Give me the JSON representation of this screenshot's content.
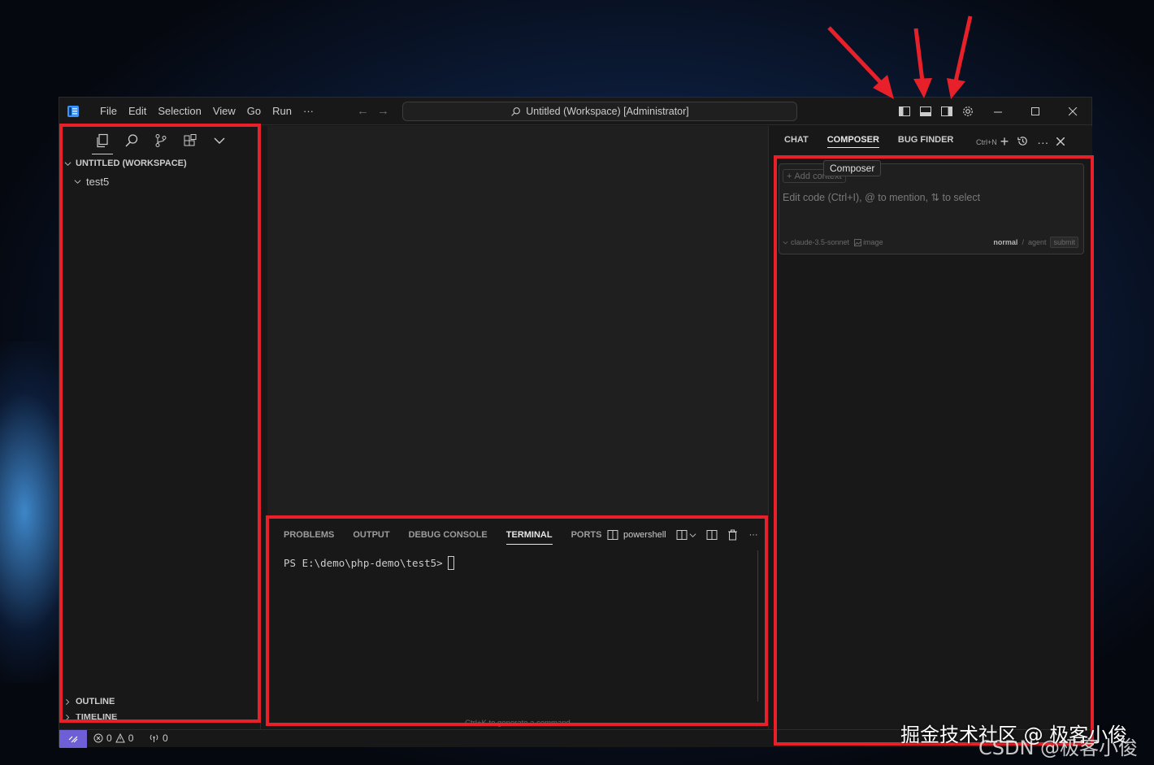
{
  "menu": [
    "File",
    "Edit",
    "Selection",
    "View",
    "Go",
    "Run",
    "···"
  ],
  "command_center": "Untitled (Workspace) [Administrator]",
  "title_icons": [
    "toggle-primary-sidebar-icon",
    "toggle-panel-icon",
    "toggle-secondary-sidebar-icon",
    "gear-icon"
  ],
  "window_controls": [
    "minimize-icon",
    "maximize-icon",
    "close-icon"
  ],
  "sidebar": {
    "activity_icons": [
      "explorer-icon",
      "search-icon",
      "source-control-icon",
      "extensions-icon",
      "chevron-down-icon"
    ],
    "root": "UNTITLED (WORKSPACE)",
    "folder": "test5",
    "outline": "OUTLINE",
    "timeline": "TIMELINE"
  },
  "panel": {
    "tabs": [
      "PROBLEMS",
      "OUTPUT",
      "DEBUG CONSOLE",
      "TERMINAL",
      "PORTS"
    ],
    "active_tab": "TERMINAL",
    "shell": "powershell",
    "prompt": "PS E:\\demo\\php-demo\\test5>",
    "hint": "Ctrl+K to generate a command"
  },
  "rightpane": {
    "tabs": [
      "CHAT",
      "COMPOSER",
      "BUG FINDER"
    ],
    "active_tab": "COMPOSER",
    "shortcut": "Ctrl+N",
    "add_context": "Add context",
    "tooltip": "Composer",
    "placeholder": "Edit code (Ctrl+I), @ to mention, ⇅ to select",
    "model": "claude-3.5-sonnet",
    "image_label": "image",
    "mode_normal": "normal",
    "mode_agent": "agent",
    "submit": "submit"
  },
  "status": {
    "errors": "0",
    "warnings": "0",
    "ports": "0"
  },
  "watermark": {
    "line1": "掘金技术社区 @ 极客小俊",
    "line2": "CSDN @极客小俊"
  },
  "colors": {
    "highlight": "#e8202a",
    "remote_button": "#6f5fd7",
    "background": "#181818"
  }
}
